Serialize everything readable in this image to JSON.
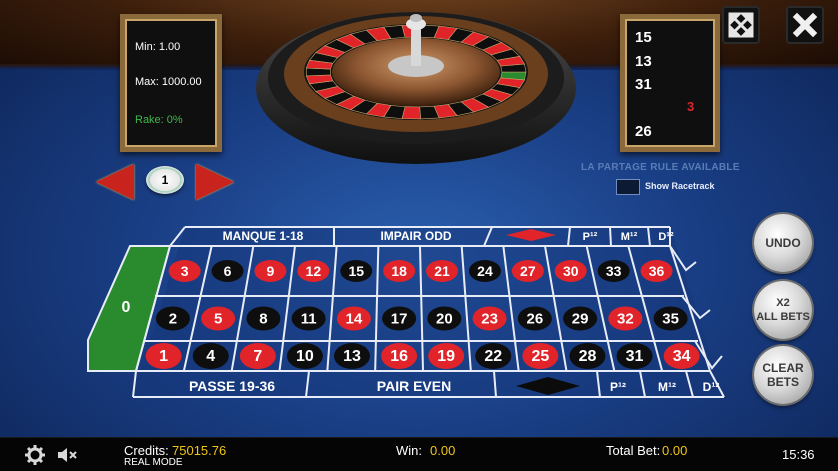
{
  "limits": {
    "min": "Min: 1.00",
    "max": "Max: 1000.00",
    "rake": "Rake: 0%"
  },
  "history": [
    "15",
    "13",
    "31",
    "3",
    "26"
  ],
  "history_colors": [
    "#ffffff",
    "#ffffff",
    "#ffffff",
    "#e0242a",
    "#ffffff"
  ],
  "chip_value": "1",
  "partage_rule": "LA PARTAGE RULE AVAILABLE",
  "racetrack_label": "Show Racetrack",
  "buttons": {
    "undo": "UNDO",
    "x2_line1": "X2",
    "x2_line2": "ALL BETS",
    "clear_line1": "CLEAR",
    "clear_line2": "BETS"
  },
  "table": {
    "zero": "0",
    "top_labels": {
      "manque": "MANQUE 1-18",
      "impair": "IMPAIR ODD",
      "p12": "P¹²",
      "m12": "M¹²",
      "d12": "D¹²"
    },
    "bottom_labels": {
      "passe": "PASSE 19-36",
      "pair": "PAIR EVEN",
      "p12": "P¹²",
      "m12": "M¹²",
      "d12": "D¹²"
    },
    "rows": [
      [
        3,
        6,
        9,
        12,
        15,
        18,
        21,
        24,
        27,
        30,
        33,
        36
      ],
      [
        2,
        5,
        8,
        11,
        14,
        17,
        20,
        23,
        26,
        29,
        32,
        35
      ],
      [
        1,
        4,
        7,
        10,
        13,
        16,
        19,
        22,
        25,
        28,
        31,
        34
      ]
    ],
    "red_numbers": [
      1,
      3,
      5,
      7,
      9,
      12,
      14,
      16,
      18,
      19,
      21,
      23,
      25,
      27,
      30,
      32,
      34,
      36
    ]
  },
  "colors": {
    "red": "#e0242a",
    "black": "#0e0e0e",
    "green": "#2a8a2e",
    "felt": "#1a3f86",
    "credit": "#f0c419"
  },
  "bottombar": {
    "credits_label": "Credits:",
    "credits_value": "75015.76",
    "mode": "REAL MODE",
    "win_label": "Win:",
    "win_value": "0.00",
    "total_bet_label": "Total Bet:",
    "total_bet_value": "0.00",
    "clock": "15:36"
  }
}
